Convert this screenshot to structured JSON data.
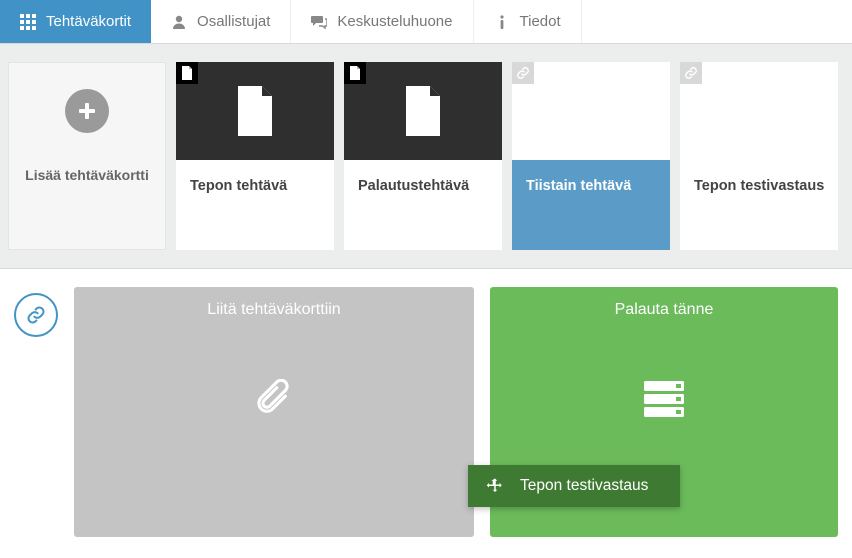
{
  "tabs": {
    "tasks": {
      "label": "Tehtäväkortit"
    },
    "participants": {
      "label": "Osallistujat"
    },
    "discussion": {
      "label": "Keskusteluhuone"
    },
    "info": {
      "label": "Tiedot"
    }
  },
  "cards": {
    "add": {
      "label": "Lisää tehtäväkortti"
    },
    "tepon": {
      "label": "Tepon tehtävä"
    },
    "palautus": {
      "label": "Palautustehtävä"
    },
    "tiistai": {
      "label": "Tiistain tehtävä"
    },
    "testivastaus": {
      "label": "Tepon testivastaus"
    }
  },
  "panels": {
    "attach": {
      "title": "Liitä tehtäväkorttiin"
    },
    "return": {
      "title": "Palauta tänne"
    }
  },
  "drag_item": {
    "label": "Tepon testivastaus"
  }
}
